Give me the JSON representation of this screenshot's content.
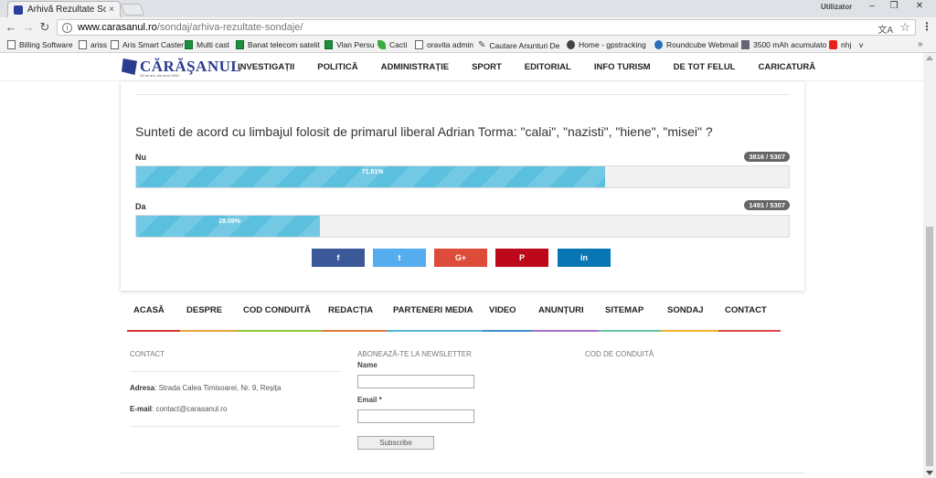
{
  "browser": {
    "tab_title": "Arhivă Rezultate Sondaje",
    "tab_close": "×",
    "profile_name": "Utilizator",
    "window_controls": [
      "–",
      "❐",
      "✕"
    ],
    "url_host": "www.carasanul.ro",
    "url_path": "/sondaj/arhiva-rezultate-sondaje/",
    "bookmarks": [
      {
        "label": "Billing Software",
        "icon": "page-icon"
      },
      {
        "label": "ariss",
        "icon": "page-icon"
      },
      {
        "label": "Aris Smart Caster",
        "icon": "page-icon"
      },
      {
        "label": "Multi cast",
        "icon": "sheet-icon"
      },
      {
        "label": "Banat telecom satelit",
        "icon": "sheet-icon"
      },
      {
        "label": "Vlan Persu",
        "icon": "sheet-icon"
      },
      {
        "label": "Cacti",
        "icon": "leaf-icon"
      },
      {
        "label": "oravita admin",
        "icon": "page-icon"
      },
      {
        "label": "Cautare Anunturi De",
        "icon": "wrench-icon"
      },
      {
        "label": "Home - gpstracking",
        "icon": "globe-icon"
      },
      {
        "label": "Roundcube Webmail",
        "icon": "roundcube-icon"
      },
      {
        "label": "3500 mAh acumulato",
        "icon": "image-icon"
      },
      {
        "label": "nhj",
        "icon": "youtube-icon"
      },
      {
        "label": "v",
        "icon": ""
      }
    ],
    "bookmarks_more": "»"
  },
  "site": {
    "logo_name": "CĂRĂŞANUL",
    "logo_tagline": "26 de ani, din anul 1990",
    "nav": [
      "INVESTIGAȚII",
      "POLITICĂ",
      "ADMINISTRAȚIE",
      "SPORT",
      "EDITORIAL",
      "INFO TURISM",
      "DE TOT FELUL",
      "CARICATURĂ"
    ]
  },
  "poll": {
    "question": "Sunteti de acord cu limbajul folosit de primarul liberal Adrian Torma: \"calai\", \"nazisti\", \"hiene\", \"misei\" ?",
    "options": [
      {
        "label": "Nu",
        "count": "3816 / 5307",
        "percent_text": "71.91%",
        "fraction": 0.7191
      },
      {
        "label": "Da",
        "count": "1491 / 5307",
        "percent_text": "28.09%",
        "fraction": 0.2809
      }
    ],
    "bar_color": "#5bc0de",
    "share": [
      {
        "name": "facebook",
        "glyph": "f",
        "color": "#3b5998"
      },
      {
        "name": "twitter",
        "glyph": "t",
        "color": "#55acee"
      },
      {
        "name": "google-plus",
        "glyph": "G+",
        "color": "#dd4b39"
      },
      {
        "name": "pinterest",
        "glyph": "P",
        "color": "#bd081c"
      },
      {
        "name": "linkedin",
        "glyph": "in",
        "color": "#0976b4"
      }
    ]
  },
  "footer": {
    "nav": [
      {
        "label": "ACASĂ",
        "color": "#d93434"
      },
      {
        "label": "DESPRE",
        "color": "#e8a53a"
      },
      {
        "label": "COD CONDUITĂ",
        "color": "#8dc63f"
      },
      {
        "label": "REDACȚIA",
        "color": "#e07b39"
      },
      {
        "label": "PARTENERI MEDIA",
        "color": "#4fb6d6"
      },
      {
        "label": "VIDEO",
        "color": "#3e8ed0"
      },
      {
        "label": "ANUNȚURI",
        "color": "#a670c9"
      },
      {
        "label": "SITEMAP",
        "color": "#6cc19e"
      },
      {
        "label": "SONDAJ",
        "color": "#f0b429"
      },
      {
        "label": "CONTACT",
        "color": "#d94a4a"
      }
    ],
    "contact_heading": "CONTACT",
    "address_label": "Adresa",
    "address_value": ": Strada Calea Timisoarei, Nr. 9, Reșița",
    "email_label": "E-mail",
    "email_value": ": contact@carasanul.ro",
    "newsletter_heading": "ABONEAZĂ-TE LA NEWSLETTER",
    "name_label": "Name",
    "email_field_label": "Email *",
    "subscribe_label": "Subscribe",
    "conduct_heading": "COD DE CONDUITĂ"
  }
}
